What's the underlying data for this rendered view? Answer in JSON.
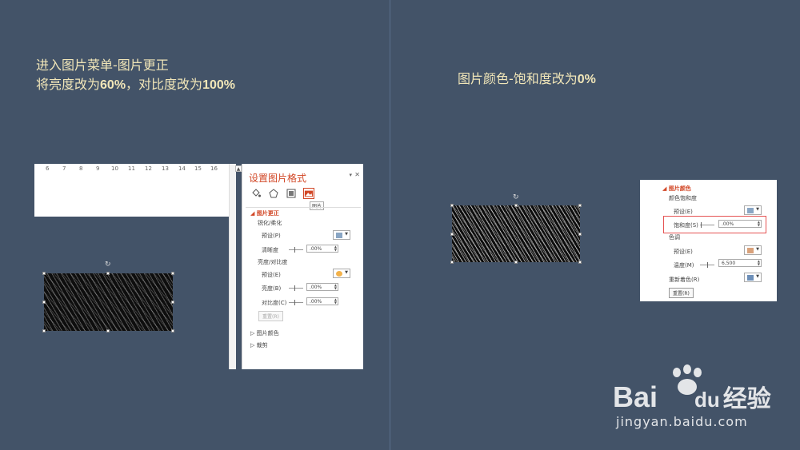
{
  "left_caption": {
    "line1": "进入图片菜单-图片更正",
    "line2_prefix": "将亮度改为",
    "line2_v1": "60%",
    "line2_mid": "，对比度改为",
    "line2_v2": "100%"
  },
  "right_caption": {
    "prefix": "图片颜色-饱和度改为",
    "value": "0%"
  },
  "ruler_marks": [
    "6",
    "7",
    "8",
    "9",
    "10",
    "11",
    "12",
    "13",
    "14",
    "15",
    "16"
  ],
  "pane_left": {
    "title": "设置图片格式",
    "tooltip": "图片",
    "section": "图片更正",
    "sharpen_head": "锐化/柔化",
    "preset1": "预设(P)",
    "clarity_label": "清晰度",
    "clarity_value": ".00%",
    "bc_head": "亮度/对比度",
    "preset2": "预设(E)",
    "brightness_label": "亮度(B)",
    "brightness_value": ".00%",
    "contrast_label": "对比度(C)",
    "contrast_value": ".00%",
    "reset": "重置(R)",
    "collapsed1": "图片颜色",
    "collapsed2": "裁剪"
  },
  "pane_right": {
    "section": "图片颜色",
    "sat_head": "颜色饱和度",
    "preset": "预设(E)",
    "sat_label": "饱和度(S)",
    "sat_value": ".00%",
    "tone_head": "色调",
    "preset2": "预设(E)",
    "temp_label": "温度(M)",
    "temp_value": "6,500",
    "recolor_label": "重新着色(R)",
    "reset": "重置(R)"
  },
  "watermark": {
    "brand1": "Bai",
    "brand2": "du",
    "brand3": "经验",
    "url": "jingyan.baidu.com"
  },
  "colors": {
    "background": "#435368",
    "caption": "#f1e6b8",
    "accent": "#d24726",
    "highlight": "#e55353"
  }
}
